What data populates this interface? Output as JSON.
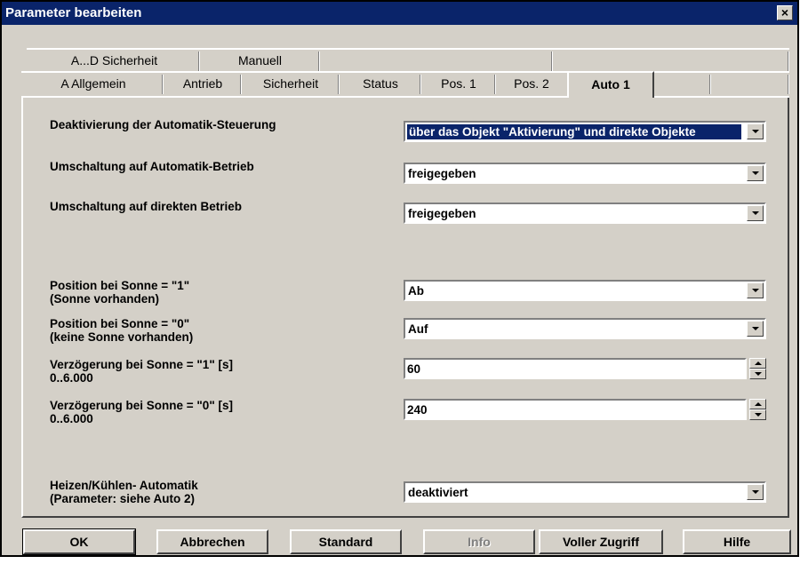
{
  "window": {
    "title": "Parameter bearbeiten",
    "close_glyph": "×"
  },
  "tabs_back": [
    {
      "label": "A...D  Sicherheit"
    },
    {
      "label": "Manuell"
    }
  ],
  "tabs_front": [
    {
      "label": "A  Allgemein"
    },
    {
      "label": "Antrieb"
    },
    {
      "label": "Sicherheit"
    },
    {
      "label": "Status"
    },
    {
      "label": "Pos. 1"
    },
    {
      "label": "Pos. 2"
    },
    {
      "label": "Auto 1",
      "active": true
    }
  ],
  "params": {
    "deakt": {
      "label": "Deaktivierung der Automatik-Steuerung",
      "value": "über das Objekt \"Aktivierung\" und direkte Objekte"
    },
    "auto_betrieb": {
      "label": "Umschaltung auf Automatik-Betrieb",
      "value": "freigegeben"
    },
    "direkt_betrieb": {
      "label": "Umschaltung auf direkten Betrieb",
      "value": "freigegeben"
    },
    "sonne1": {
      "label_line1": "Position bei Sonne = \"1\"",
      "label_line2": "(Sonne vorhanden)",
      "value": "Ab"
    },
    "sonne0": {
      "label_line1": "Position bei Sonne = \"0\"",
      "label_line2": "(keine Sonne vorhanden)",
      "value": "Auf"
    },
    "verz1": {
      "label_line1": "Verzögerung bei Sonne = \"1\" [s]",
      "label_line2": "0..6.000",
      "value": "60"
    },
    "verz0": {
      "label_line1": "Verzögerung bei Sonne = \"0\" [s]",
      "label_line2": "0..6.000",
      "value": "240"
    },
    "heizen": {
      "label_line1": "Heizen/Kühlen- Automatik",
      "label_line2": "(Parameter: siehe Auto 2)",
      "value": "deaktiviert"
    }
  },
  "buttons": {
    "ok": "OK",
    "cancel": "Abbrechen",
    "standard": "Standard",
    "info": "Info",
    "full_access": "Voller Zugriff",
    "help": "Hilfe"
  },
  "colors": {
    "titlebar": "#0a246a",
    "face": "#d4d0c8"
  }
}
